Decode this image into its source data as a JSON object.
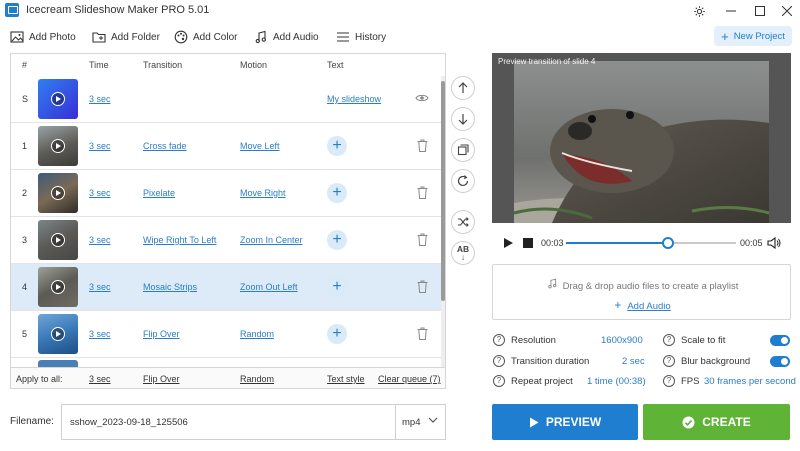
{
  "window": {
    "title": "Icecream Slideshow Maker PRO 5.01"
  },
  "toolbar": {
    "add_photo": "Add Photo",
    "add_folder": "Add Folder",
    "add_color": "Add Color",
    "add_audio": "Add Audio",
    "history": "History",
    "new_project": "New Project"
  },
  "queue": {
    "headers": {
      "num": "#",
      "time": "Time",
      "transition": "Transition",
      "motion": "Motion",
      "text": "Text"
    },
    "rows": [
      {
        "num": "S",
        "time": "3 sec",
        "transition": "",
        "motion": "",
        "text": "My slideshow",
        "type": "title"
      },
      {
        "num": "1",
        "time": "3 sec",
        "transition": "Cross fade",
        "motion": "Move Left"
      },
      {
        "num": "2",
        "time": "3 sec",
        "transition": "Pixelate",
        "motion": "Move Right"
      },
      {
        "num": "3",
        "time": "3 sec",
        "transition": "Wipe Right To Left",
        "motion": "Zoom In Center"
      },
      {
        "num": "4",
        "time": "3 sec",
        "transition": "Mosaic Strips",
        "motion": "Zoom Out Left",
        "selected": true
      },
      {
        "num": "5",
        "time": "3 sec",
        "transition": "Flip Over",
        "motion": "Random"
      }
    ],
    "footer": {
      "apply_label": "Apply to all:",
      "time": "3 sec",
      "transition": "Flip Over",
      "motion": "Random",
      "text_style": "Text style",
      "clear_queue": "Clear queue (7)"
    }
  },
  "preview": {
    "label": "Preview transition of slide 4",
    "current_time": "00:03",
    "total_time": "00:05",
    "progress": 0.6
  },
  "audio": {
    "drop_text": "Drag & drop audio files to create a playlist",
    "add_audio": "Add Audio"
  },
  "settings": {
    "resolution_label": "Resolution",
    "resolution_value": "1600x900",
    "transition_label": "Transition duration",
    "transition_value": "2 sec",
    "repeat_label": "Repeat project",
    "repeat_value": "1 time (00:38)",
    "scale_label": "Scale to fit",
    "scale_on": true,
    "blur_label": "Blur background",
    "blur_on": true,
    "fps_label": "FPS",
    "fps_value": "30 frames per second"
  },
  "filename": {
    "label": "Filename:",
    "value": "sshow_2023-09-18_125506",
    "format": "mp4"
  },
  "actions": {
    "preview": "PREVIEW",
    "create": "CREATE"
  },
  "colors": {
    "accent_blue": "#1f7ecf",
    "create_green": "#5fb336",
    "selected_row": "#dcebf7"
  }
}
